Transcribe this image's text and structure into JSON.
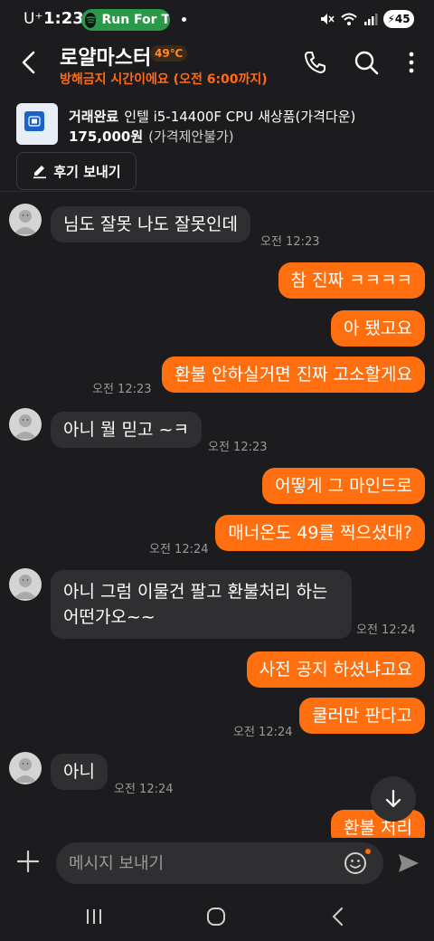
{
  "status_bar": {
    "carrier": "U⁺",
    "time": "1:23",
    "media_pill": "Run For T",
    "battery": "45"
  },
  "header": {
    "title": "로얄마스터",
    "temperature": "49℃",
    "subtitle": "방해금지 시간이에요 (오전 6:00까지)"
  },
  "product": {
    "status": "거래완료",
    "name": "인텔 i5-14400F CPU 새상품(가격다운)",
    "price": "175,000원",
    "price_note": "(가격제안불가)",
    "review_button": "후기 보내기"
  },
  "messages": [
    {
      "side": "in",
      "text": "님도 잘못 나도 잘못인데",
      "time": "오전 12:23"
    },
    {
      "side": "out",
      "text": "참 진짜 ㅋㅋㅋㅋ"
    },
    {
      "side": "out",
      "text": "아 됐고요"
    },
    {
      "side": "out",
      "text": "환불 안하실거면 진짜 고소할게요",
      "time": "오전 12:23"
    },
    {
      "side": "in",
      "text": "아니 뭘 믿고 ~ㅋ",
      "time": "오전 12:23"
    },
    {
      "side": "out",
      "text": "어떻게 그 마인드로"
    },
    {
      "side": "out",
      "text": "매너온도 49를 찍으셨대?",
      "time": "오전 12:24"
    },
    {
      "side": "in",
      "text": "아니 그럼 이물건 팔고 환불처리 하는 어떤가오~~",
      "time": "오전 12:24"
    },
    {
      "side": "out",
      "text": "사전 공지 하셨냐고요"
    },
    {
      "side": "out",
      "text": "쿨러만 판다고",
      "time": "오전 12:24"
    },
    {
      "side": "in",
      "text": "아니",
      "time": "오전 12:24"
    },
    {
      "side": "out",
      "text": "환불 처리"
    }
  ],
  "input": {
    "placeholder": "메시지 보내기"
  },
  "colors": {
    "accent": "#ff6f0f",
    "background": "#1c1c1e",
    "incoming_bubble": "#2f2f31"
  },
  "icons": [
    "back-icon",
    "phone-icon",
    "search-icon",
    "more-icon",
    "pencil-icon",
    "plus-icon",
    "emoji-icon",
    "send-icon",
    "scroll-down-icon",
    "recents-icon",
    "home-icon",
    "nav-back-icon"
  ]
}
